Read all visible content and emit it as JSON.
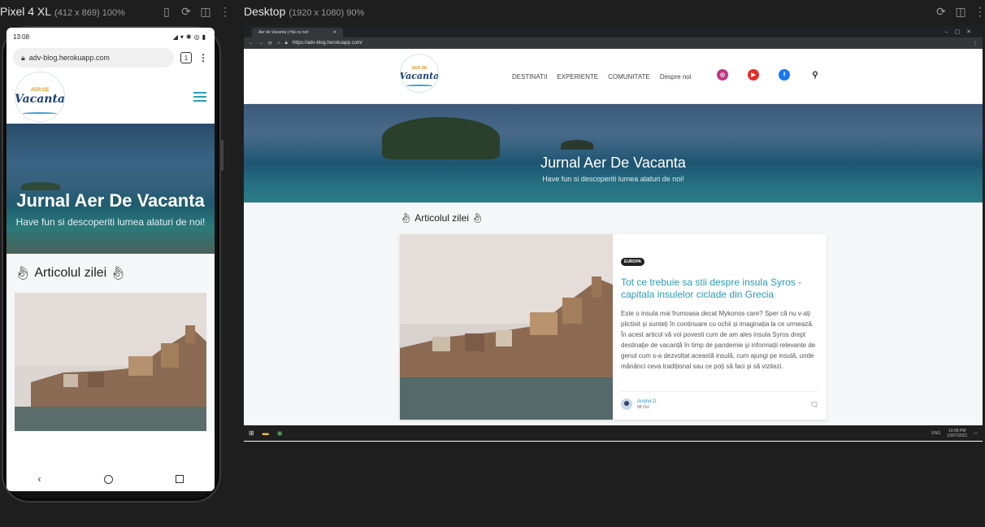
{
  "phone_label": {
    "device": "Pixel 4 XL",
    "meta": "(412 x 869) 100%"
  },
  "desktop_label": {
    "device": "Desktop",
    "meta": "(1920 x 1080) 90%"
  },
  "mobile": {
    "status_time": "13:08",
    "url": "adv-blog.herokuapp.com",
    "tab_count": "1",
    "logo_top": "AER DE",
    "logo_main": "Vacanta",
    "hero_title": "Jurnal Aer De Vacanta",
    "hero_sub": "Have fun si descoperiti lumea alaturi de noi!",
    "section_title": "Articolul zilei"
  },
  "desktop": {
    "tab_title": "Aer de Vacanta | Hai cu noi!",
    "url": "https://adv-blog.herokuapp.com/",
    "nav": [
      "DESTINATII",
      "EXPERIENTE",
      "COMUNITATE",
      "Despre noi"
    ],
    "hero_title": "Jurnal Aer De Vacanta",
    "hero_sub": "Have fun si descoperiti lumea alaturi de noi!",
    "section_title": "Articolul zilei",
    "article": {
      "badge": "EUROPA",
      "title": "Tot ce trebuie sa stii despre insula Syros - capitala insulelor ciclade din Grecia",
      "excerpt": "Este o insula mai frumoasa decat Mykonos care? Sper că nu v-ați plictisit și sunteți în continuare cu ochii și imaginația la ce urmează. În acest articol vă voi povesti cum de am ales insula Syros drept destinație de vacanță în timp de pandemie și informații relevante de genul cum s-a dezvoltat această insulă, cum ajungi pe insulă, unde mănânci ceva tradițional sau ce poți să faci și să vizitezi.",
      "author": "Andrei D.",
      "date": "08 Oct"
    },
    "taskbar": {
      "lang": "ENG",
      "time": "10:08 PM",
      "date": "10/07/2021"
    }
  },
  "colors": {
    "accent": "#2a9bb5",
    "instagram": "#c13584",
    "youtube": "#e52d27",
    "facebook": "#1877f2"
  }
}
